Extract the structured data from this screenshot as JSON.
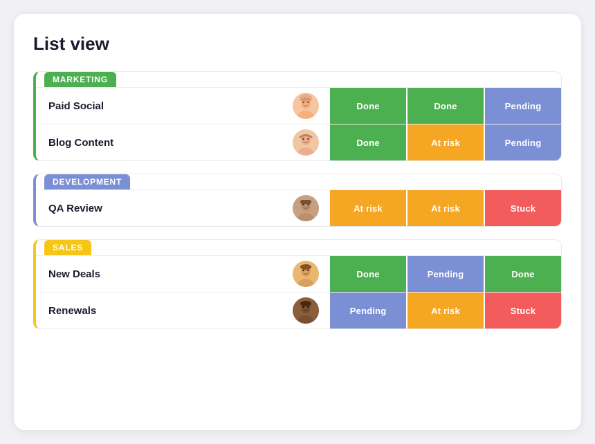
{
  "title": "List view",
  "groups": [
    {
      "id": "marketing",
      "label": "MARKETING",
      "colorClass": "marketing",
      "rows": [
        {
          "name": "Paid Social",
          "avatarClass": "av1",
          "avatarEmoji": "👩",
          "statuses": [
            {
              "label": "Done",
              "cls": "status-done"
            },
            {
              "label": "Done",
              "cls": "status-done"
            },
            {
              "label": "Pending",
              "cls": "status-pending"
            }
          ]
        },
        {
          "name": "Blog Content",
          "avatarClass": "av2",
          "avatarEmoji": "👩",
          "statuses": [
            {
              "label": "Done",
              "cls": "status-done"
            },
            {
              "label": "At risk",
              "cls": "status-atrisk"
            },
            {
              "label": "Pending",
              "cls": "status-pending"
            }
          ]
        }
      ]
    },
    {
      "id": "development",
      "label": "DEVELOPMENT",
      "colorClass": "development",
      "rows": [
        {
          "name": "QA Review",
          "avatarClass": "av3",
          "avatarEmoji": "👨",
          "statuses": [
            {
              "label": "At risk",
              "cls": "status-atrisk"
            },
            {
              "label": "At risk",
              "cls": "status-atrisk"
            },
            {
              "label": "Stuck",
              "cls": "status-stuck"
            }
          ]
        }
      ]
    },
    {
      "id": "sales",
      "label": "SALES",
      "colorClass": "sales",
      "rows": [
        {
          "name": "New Deals",
          "avatarClass": "av4",
          "avatarEmoji": "👨",
          "statuses": [
            {
              "label": "Done",
              "cls": "status-done"
            },
            {
              "label": "Pending",
              "cls": "status-pending"
            },
            {
              "label": "Done",
              "cls": "status-done"
            }
          ]
        },
        {
          "name": "Renewals",
          "avatarClass": "av5",
          "avatarEmoji": "👨",
          "statuses": [
            {
              "label": "Pending",
              "cls": "status-pending"
            },
            {
              "label": "At risk",
              "cls": "status-atrisk"
            },
            {
              "label": "Stuck",
              "cls": "status-stuck"
            }
          ]
        }
      ]
    }
  ]
}
